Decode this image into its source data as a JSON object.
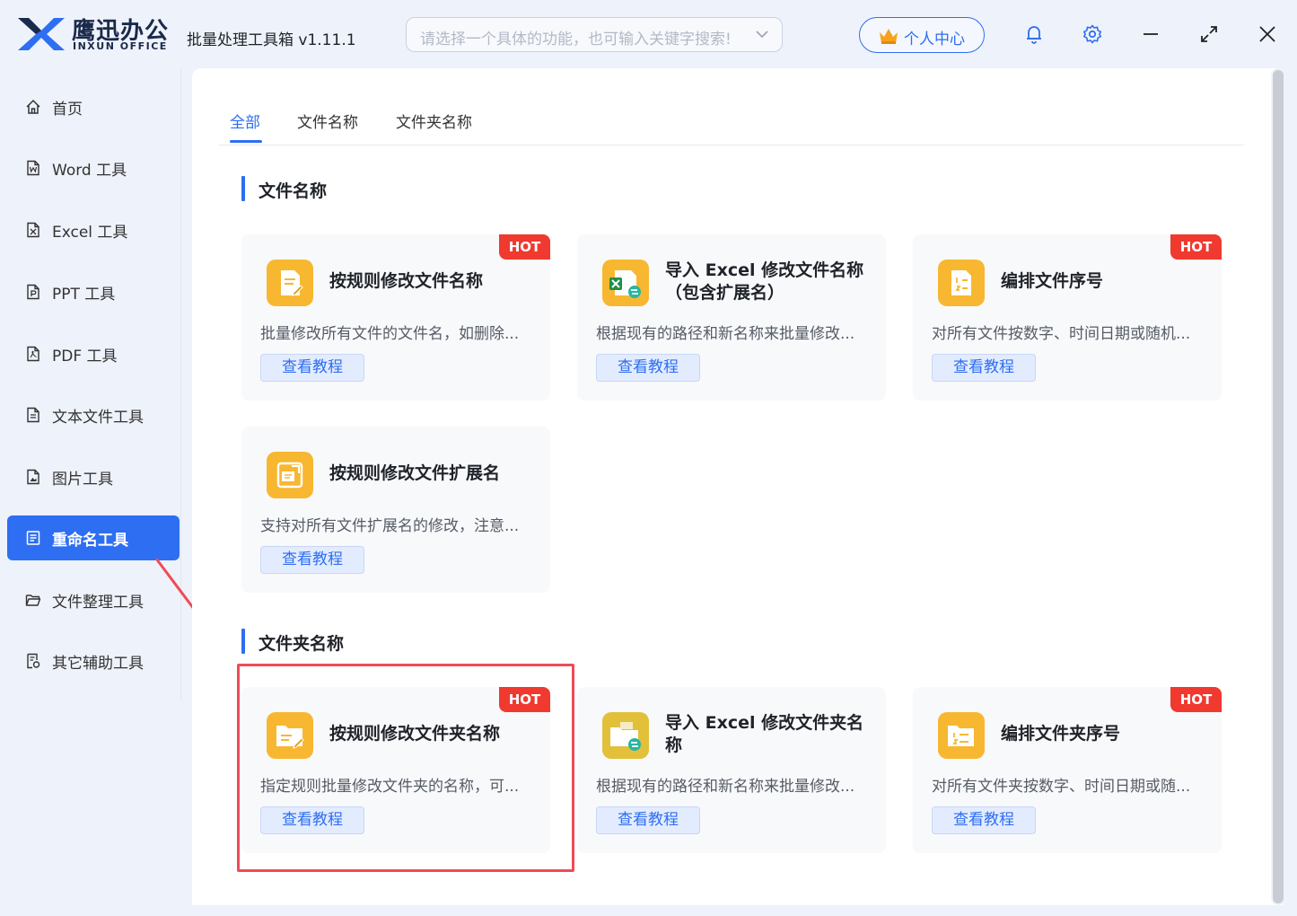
{
  "app": {
    "brand_cn": "鹰迅办公",
    "brand_en": "INXUN OFFICE",
    "title": "批量处理工具箱 v1.11.1"
  },
  "search": {
    "placeholder": "请选择一个具体的功能，也可输入关键字搜索!"
  },
  "header": {
    "user_center": "个人中心"
  },
  "sidebar": {
    "items": [
      {
        "label": "首页",
        "icon": "home-icon"
      },
      {
        "label": "Word 工具",
        "icon": "word-file-icon"
      },
      {
        "label": "Excel 工具",
        "icon": "excel-file-icon"
      },
      {
        "label": "PPT 工具",
        "icon": "ppt-file-icon"
      },
      {
        "label": "PDF 工具",
        "icon": "pdf-file-icon"
      },
      {
        "label": "文本文件工具",
        "icon": "text-file-icon"
      },
      {
        "label": "图片工具",
        "icon": "image-file-icon"
      },
      {
        "label": "重命名工具",
        "icon": "rename-icon",
        "active": true
      },
      {
        "label": "文件整理工具",
        "icon": "folder-icon"
      },
      {
        "label": "其它辅助工具",
        "icon": "tools-icon"
      }
    ]
  },
  "tabs": [
    {
      "label": "全部",
      "active": true
    },
    {
      "label": "文件名称"
    },
    {
      "label": "文件夹名称"
    }
  ],
  "sections": {
    "file_name": {
      "heading": "文件名称",
      "cards": [
        {
          "title": "按规则修改文件名称",
          "desc": "批量修改所有文件的文件名，如删除...",
          "button": "查看教程",
          "badge": "HOT"
        },
        {
          "title": "导入 Excel 修改文件名称（包含扩展名）",
          "desc": "根据现有的路径和新名称来批量修改...",
          "button": "查看教程"
        },
        {
          "title": "编排文件序号",
          "desc": "对所有文件按数字、时间日期或随机...",
          "button": "查看教程",
          "badge": "HOT"
        },
        {
          "title": "按规则修改文件扩展名",
          "desc": "支持对所有文件扩展名的修改，注意...",
          "button": "查看教程"
        }
      ]
    },
    "folder_name": {
      "heading": "文件夹名称",
      "cards": [
        {
          "title": "按规则修改文件夹名称",
          "desc": "指定规则批量修改文件夹的名称，可...",
          "button": "查看教程",
          "badge": "HOT"
        },
        {
          "title": "导入 Excel 修改文件夹名称",
          "desc": "根据现有的路径和新名称来批量修改...",
          "button": "查看教程"
        },
        {
          "title": "编排文件夹序号",
          "desc": "对所有文件夹按数字、时间日期或随...",
          "button": "查看教程",
          "badge": "HOT"
        }
      ]
    }
  },
  "colors": {
    "accent": "#2e6ef2",
    "hot": "#f0392f",
    "icon": "#f8b731",
    "highlight": "#ef4b55"
  }
}
